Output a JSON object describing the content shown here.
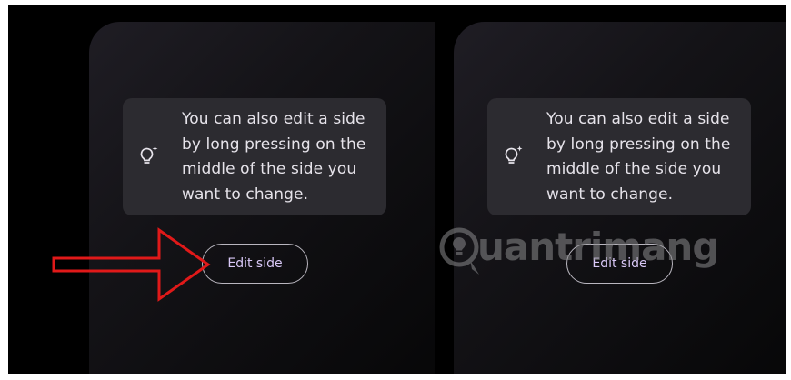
{
  "screens": [
    {
      "tip_text": "You can also edit a side by long pressing on the middle of the side you want to change.",
      "tip_icon": "lightbulb-sparkle-icon",
      "button_label": "Edit side"
    },
    {
      "tip_text": "You can also edit a side by long pressing on the middle of the side you want to change.",
      "tip_icon": "lightbulb-sparkle-icon",
      "button_label": "Edit side"
    }
  ],
  "annotation": {
    "arrow_color": "#e01919",
    "points_to": "edit-side-button"
  },
  "watermark": {
    "text": "uantrimang"
  },
  "colors": {
    "background": "#000000",
    "card": "#2c2b30",
    "tip_text": "#e6e3ea",
    "button_text": "#d9c8f7",
    "button_border": "#b9b6bf"
  }
}
